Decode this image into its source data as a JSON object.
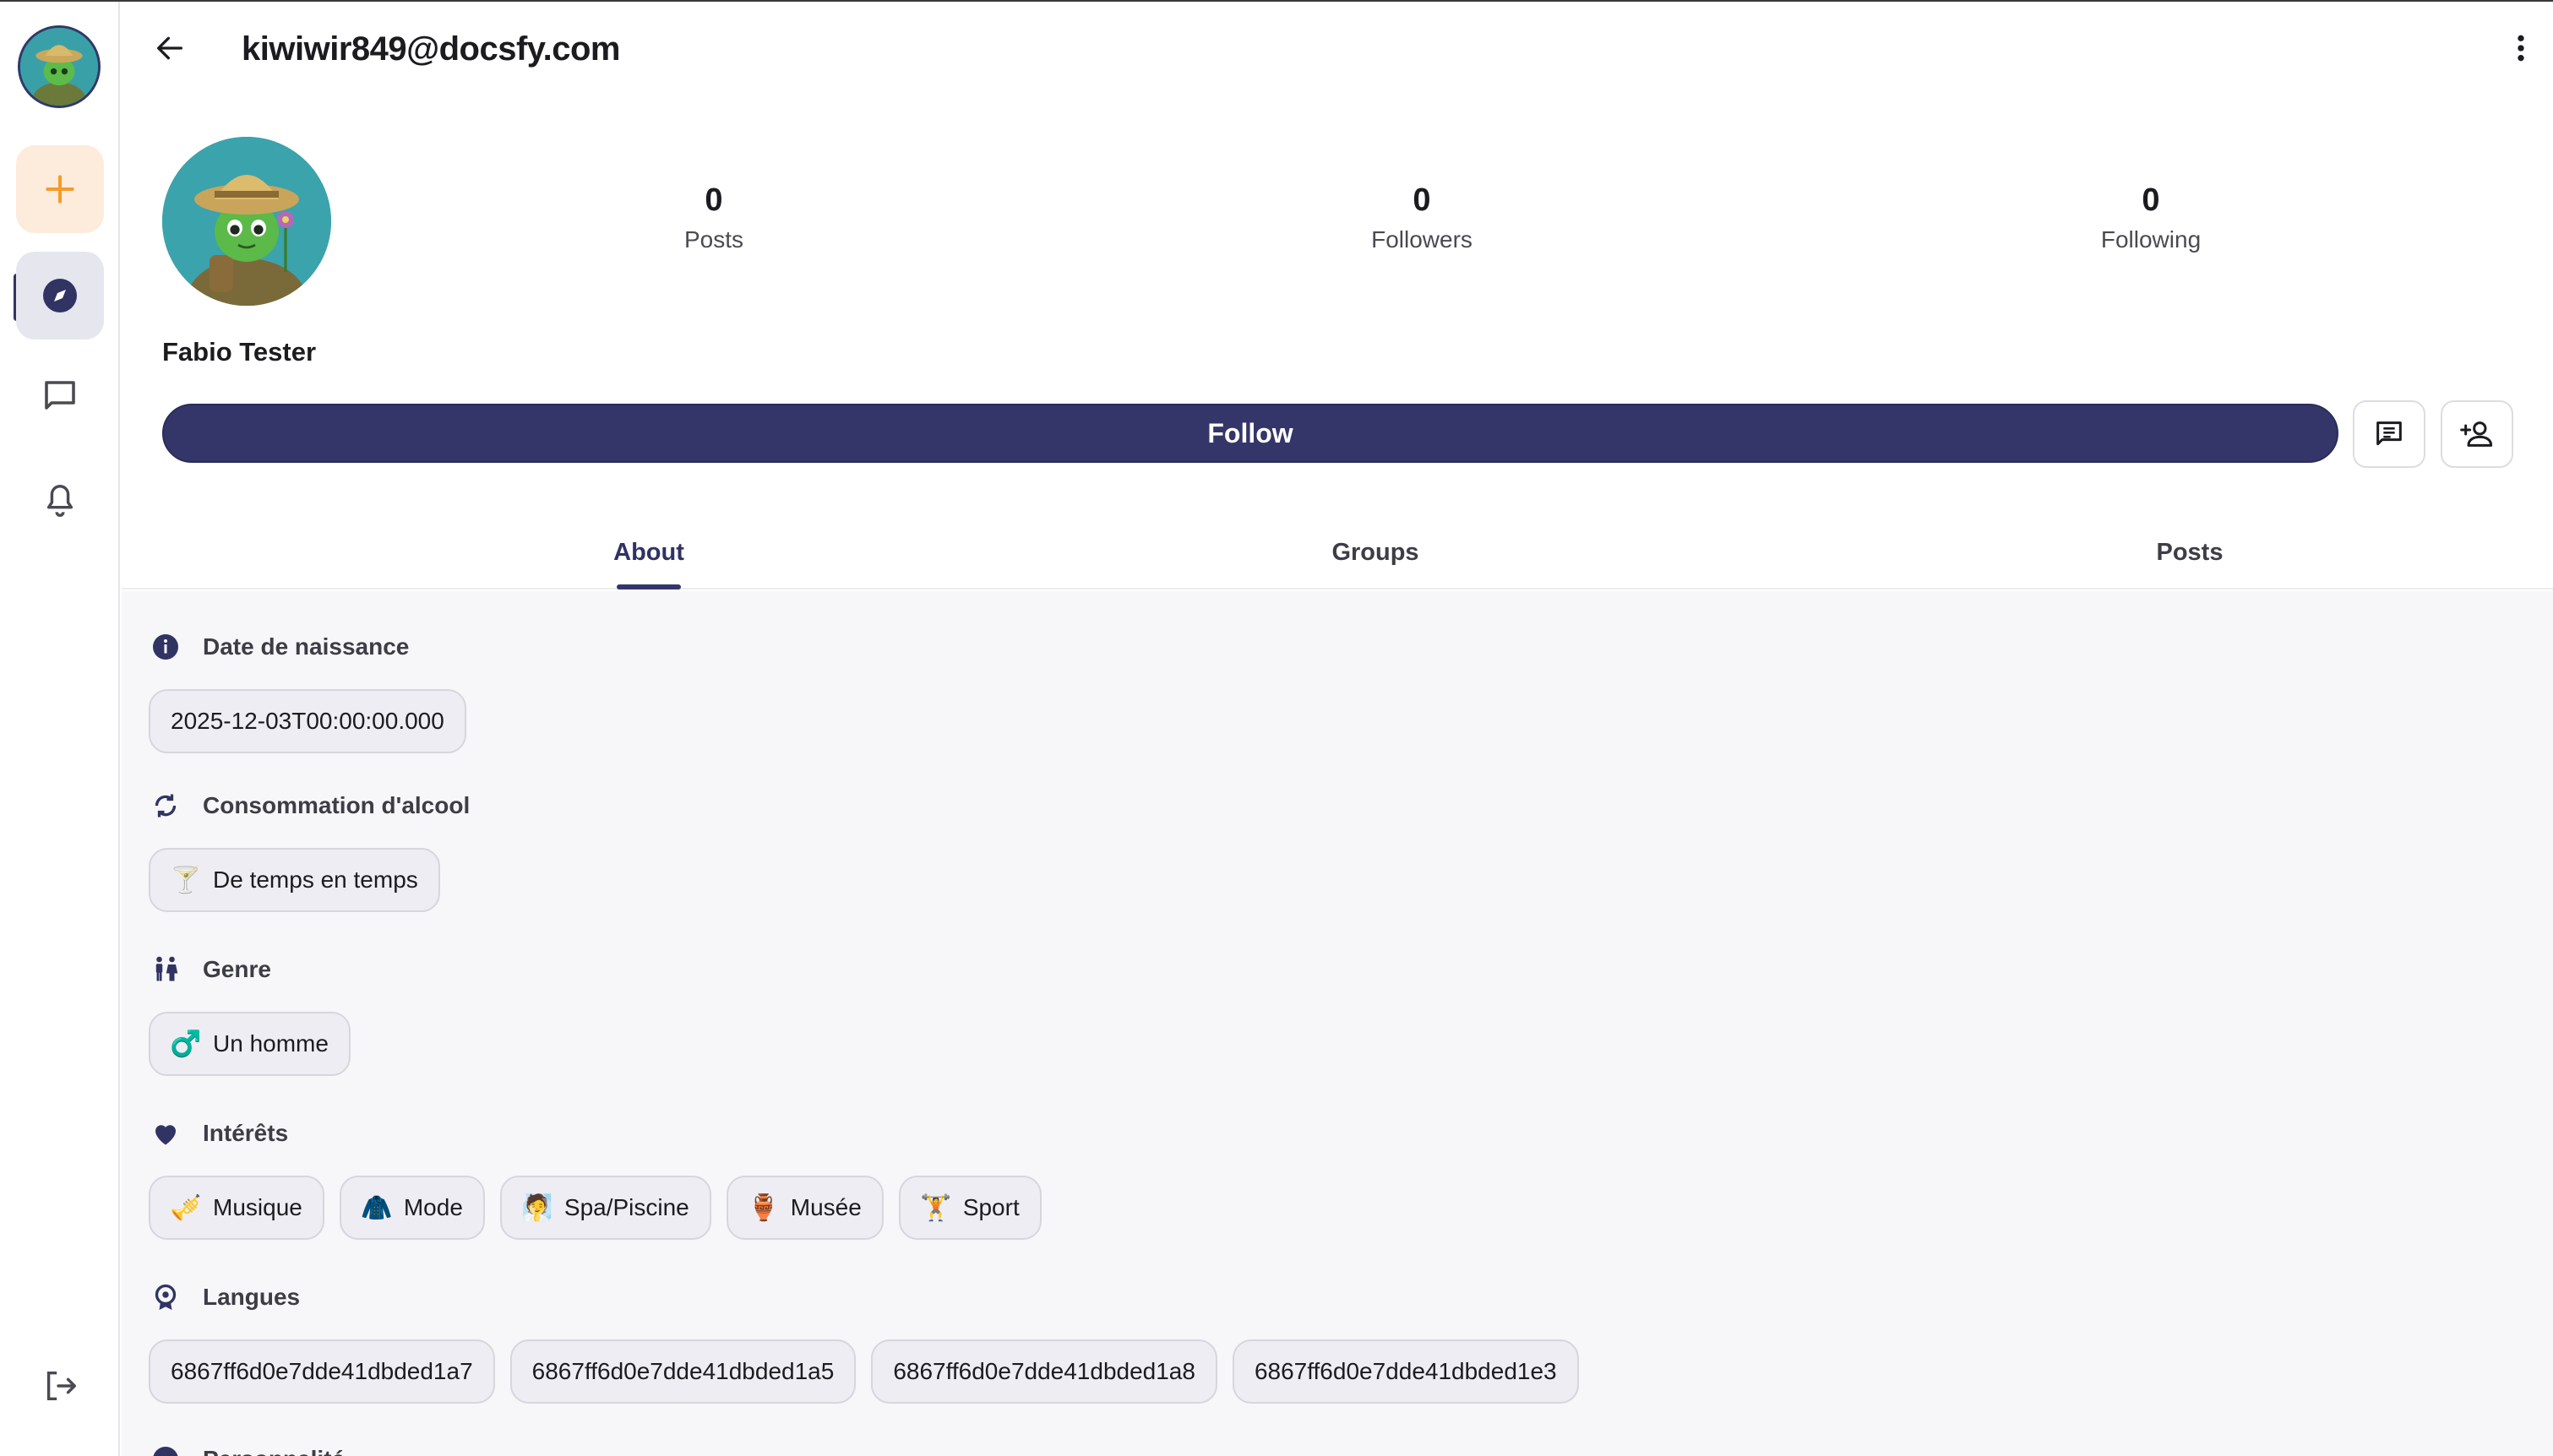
{
  "header": {
    "title": "kiwiwir849@docsfy.com"
  },
  "sidebar": {
    "items": [
      {
        "icon": "add-icon"
      },
      {
        "icon": "explore-icon"
      },
      {
        "icon": "chat-icon"
      },
      {
        "icon": "bell-icon"
      },
      {
        "icon": "logout-icon"
      }
    ],
    "accent": "#f59a2c"
  },
  "profile": {
    "name": "Fabio Tester",
    "stats": [
      {
        "value": "0",
        "label": "Posts"
      },
      {
        "value": "0",
        "label": "Followers"
      },
      {
        "value": "0",
        "label": "Following"
      }
    ],
    "follow_label": "Follow",
    "primary_color": "#343669"
  },
  "tabs": [
    {
      "label": "About",
      "active": true
    },
    {
      "label": "Groups",
      "active": false
    },
    {
      "label": "Posts",
      "active": false
    }
  ],
  "about": {
    "birthdate": {
      "title": "Date de naissance",
      "value": "2025-12-03T00:00:00.000"
    },
    "alcohol": {
      "title": "Consommation d'alcool",
      "value": "De temps en temps",
      "emoji": "🍸"
    },
    "gender": {
      "title": "Genre",
      "value": "Un homme",
      "emoji": "♂️"
    },
    "interests": {
      "title": "Intérêts",
      "items": [
        {
          "emoji": "🎺",
          "label": "Musique"
        },
        {
          "emoji": "🧥",
          "label": "Mode"
        },
        {
          "emoji": "🧖",
          "label": "Spa/Piscine"
        },
        {
          "emoji": "🏺",
          "label": "Musée"
        },
        {
          "emoji": "🏋️",
          "label": "Sport"
        }
      ]
    },
    "languages": {
      "title": "Langues",
      "items": [
        "6867ff6d0e7dde41dbded1a7",
        "6867ff6d0e7dde41dbded1a5",
        "6867ff6d0e7dde41dbded1a8",
        "6867ff6d0e7dde41dbded1e3"
      ]
    },
    "personality": {
      "title": "Personnalité"
    }
  }
}
